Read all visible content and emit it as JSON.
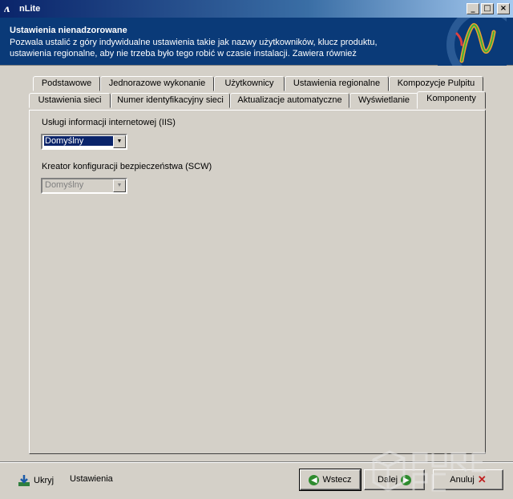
{
  "window": {
    "title": "nLite",
    "app_icon_glyph": "ʌ"
  },
  "window_buttons": {
    "minimize": "_",
    "maximize": "□",
    "close": "×"
  },
  "header": {
    "title": "Ustawienia nienadzorowane",
    "description": "Pozwala ustalić z góry indywidualne ustawienia takie jak nazwy użytkowników, klucz produktu, ustawienia regionalne, aby nie trzeba było tego robić w czasie instalacji. Zawiera również"
  },
  "tabs": {
    "row1": [
      "Podstawowe",
      "Jednorazowe wykonanie",
      "Użytkownicy",
      "Ustawienia regionalne",
      "Kompozycje Pulpitu"
    ],
    "row2": [
      "Ustawienia sieci",
      "Numer identyfikacyjny sieci",
      "Aktualizacje automatyczne",
      "Wyświetlanie",
      "Komponenty"
    ],
    "active": "Komponenty"
  },
  "panel": {
    "iis_label": "Usługi informacji internetowej (IIS)",
    "iis_value": "Domyślny",
    "scw_label": "Kreator konfiguracji bezpieczeństwa (SCW)",
    "scw_value": "Domyślny"
  },
  "bottom": {
    "hide_label": "Ukryj",
    "settings_label": "Ustawienia",
    "back_label": "Wstecz",
    "next_label": "Dalej",
    "cancel_label": "Anuluj"
  },
  "watermark": {
    "text": "PURE PC"
  },
  "colors": {
    "header_bg": "#0a3a78",
    "title_gradient_start": "#0a246a",
    "selection": "#0a246a",
    "face": "#d4d0c8"
  }
}
